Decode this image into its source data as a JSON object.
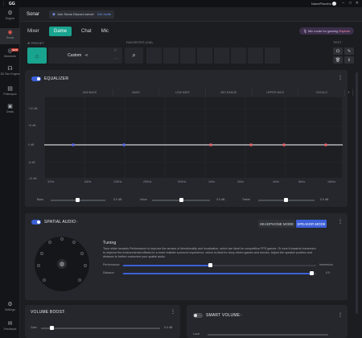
{
  "window": {
    "app": "GG",
    "username": "NamePlaceho",
    "controls": [
      "–",
      "□",
      "✕"
    ]
  },
  "rail": {
    "items": [
      {
        "label": "Engine",
        "icon": "engine-icon",
        "glyph": "⚙"
      },
      {
        "label": "Sonar",
        "icon": "sonar-icon",
        "glyph": "◉"
      },
      {
        "label": "Moments",
        "icon": "moments-icon",
        "glyph": "◎",
        "badge": "NEW"
      },
      {
        "label": "3D Sim Engine",
        "icon": "sim-icon",
        "glyph": "☊"
      },
      {
        "label": "Prismsync",
        "icon": "prismsync-icon",
        "glyph": "▤"
      },
      {
        "label": "Deals",
        "icon": "deals-icon",
        "glyph": "▣"
      },
      {
        "label": "Settings",
        "icon": "settings-icon",
        "glyph": "⚙"
      },
      {
        "label": "Feedback",
        "icon": "feedback-icon",
        "glyph": "✉"
      }
    ]
  },
  "topbar": {
    "title": "Sonar",
    "discord_text": "Join Sonar Discord server",
    "discord_link": "Get Invite"
  },
  "tabs": {
    "items": [
      "Mixer",
      "Game",
      "Chat",
      "Mic"
    ],
    "active": "Game"
  },
  "mic_promo": {
    "text": "Mic mode for gaming",
    "cta": "Explore"
  },
  "preset": {
    "label": "PRESET",
    "name": "Custom",
    "favorites_label": "FAVORITES (0/8)",
    "test_label": "TEST"
  },
  "equalizer": {
    "title": "EQUALIZER",
    "bands": [
      "SUB BASS",
      "BASS",
      "LOW MIDS",
      "MID RANGE",
      "UPPER MIDS",
      "VOCALS"
    ],
    "y_labels": [
      "+12 dB",
      "+6 dB",
      "0 dB",
      "-6 dB",
      "-12 dB"
    ],
    "x_labels": [
      "32Hz",
      "64Hz",
      "125Hz",
      "250Hz",
      "500Hz",
      "1kHz",
      "2kHz",
      "4kHz",
      "8kHz",
      "16kHz"
    ],
    "sliders": [
      {
        "label": "Bass",
        "value": "0.0 dB"
      },
      {
        "label": "Voice",
        "value": "0.0 dB"
      },
      {
        "label": "Treble",
        "value": "0.0 dB"
      }
    ]
  },
  "spatial": {
    "title": "SPATIAL AUDIO",
    "mode_headphone": "HEADPHONE MODE",
    "mode_speaker": "SPEAKER MODE",
    "tuning_title": "Tuning",
    "tuning_desc_1": "Tune slider towards Performance to improve the senses of directionality and localization, which are ideal for competitive FPS games. Or tune it towards Immersion",
    "tuning_desc_2": "to improve the environmental effects for a more realistic surround experience, which is ideal for story driven games and movies. Adjust the speaker position and",
    "tuning_desc_3": "distance to further customize your spatial audio.",
    "performance_label": "Performance",
    "immersion_label": "Immersion",
    "distance_label": "Distance",
    "distance_value": "0.0",
    "performance_level": 0.45,
    "distance_level": 0.98
  },
  "volume_boost": {
    "title": "VOLUME BOOST",
    "label": "Gain",
    "value": "0.0 dB"
  },
  "smart_volume": {
    "title": "SMART VOLUME",
    "label": "Loud"
  },
  "colors": {
    "accent": "#19a48f",
    "toggle_on": "#3c5fd8",
    "eq_line": "#ffffff"
  }
}
